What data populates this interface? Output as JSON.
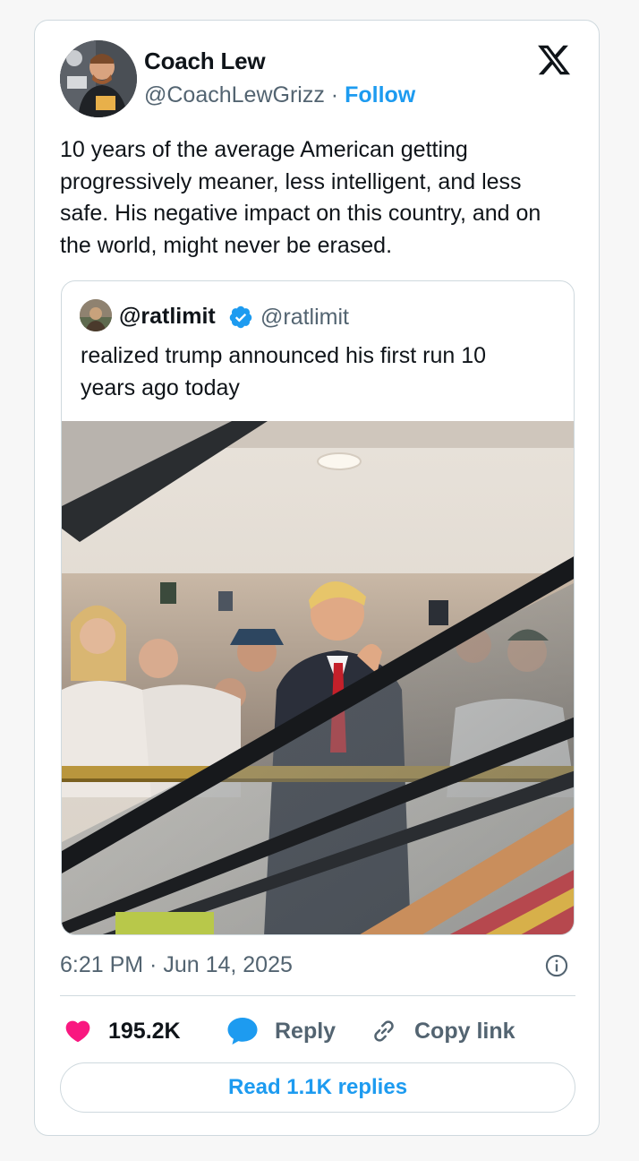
{
  "author": {
    "name": "Coach Lew",
    "handle": "@CoachLewGrizz",
    "separator": "·",
    "follow_label": "Follow"
  },
  "logo_icon": "x-logo-icon",
  "tweet_text": "10 years of the average American getting progressively meaner, less intelligent, and less safe. His negative impact on this country, and on the world, might never be erased.",
  "quoted_tweet": {
    "name": "@ratlimit",
    "handle": "@ratlimit",
    "verified": true,
    "text": "realized trump announced his first run 10 years ago today",
    "photo_description": "Man in dark suit and red tie giving thumbs up on an escalator, crowd with phones behind him"
  },
  "timestamp": "6:21 PM · Jun 14, 2025",
  "actions": {
    "like_count": "195.2K",
    "reply_label": "Reply",
    "copy_link_label": "Copy link"
  },
  "read_replies_label": "Read 1.1K replies",
  "colors": {
    "accent": "#1d9bf0",
    "like": "#f91880",
    "secondary_text": "#536471",
    "border": "#cfd9de"
  }
}
